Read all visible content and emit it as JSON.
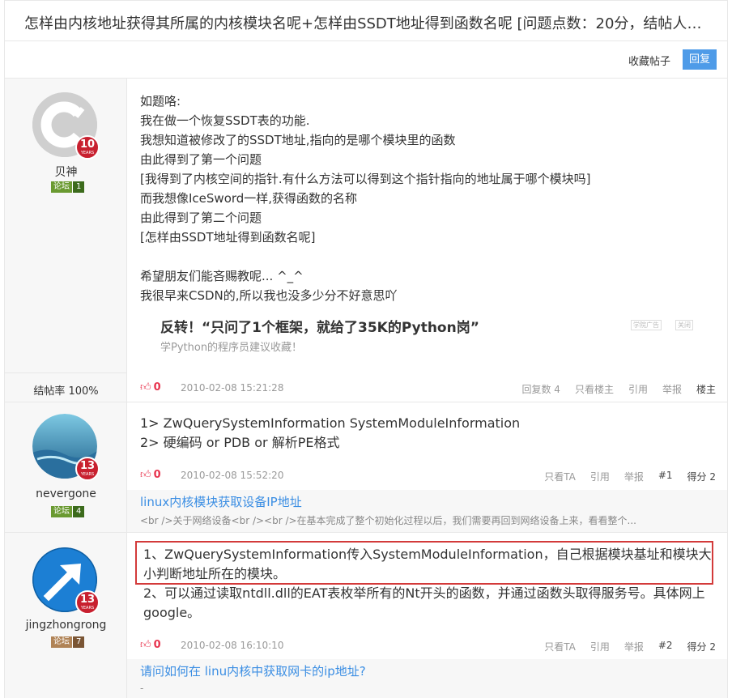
{
  "thread": {
    "title": "怎样由内核地址获得其所属的内核模块名呢+怎样由SSDT地址得到函数名呢 [问题点数：20分，结帖人w...",
    "fav_label": "收藏帖子",
    "reply_label": "回复"
  },
  "posts": [
    {
      "user": "贝神",
      "years": "10",
      "years_label": "YEARS",
      "badge_type": "论坛",
      "badge_level": "1",
      "rate": "结帖率 100%",
      "text": "如题咯:\n我在做一个恢复SSDT表的功能.\n我想知道被修改了的SSDT地址,指向的是哪个模块里的函数\n由此得到了第一个问题\n[我得到了内核空间的指针.有什么方法可以得到这个指针指向的地址属于哪个模块吗]\n而我想像IceSword一样,获得函数的名称\n由此得到了第二个问题\n[怎样由SSDT地址得到函数名呢]\n\n希望朋友们能吝赐教呢...  ^_^\n我很早来CSDN的,所以我也没多少分不好意思吖",
      "ad_title": "反转！“只问了1个框架，就给了35K的Python岗”",
      "ad_sub": "学Python的程序员建议收藏！",
      "ad_tag1": "学院广告",
      "ad_tag2": "关闭",
      "likes": "0",
      "time": "2010-02-08 15:21:28",
      "actions": [
        "回复数 4",
        "只看楼主",
        "引用",
        "举报",
        "楼主"
      ]
    },
    {
      "user": "nevergone",
      "years": "13",
      "years_label": "YEARS",
      "badge_type": "论坛",
      "badge_level": "4",
      "text": "1> ZwQuerySystemInformation SystemModuleInformation\n2> 硬编码 or PDB or 解析PE格式",
      "likes": "0",
      "time": "2010-02-08 15:52:20",
      "actions": [
        "只看TA",
        "引用",
        "举报",
        "#1",
        "得分 2"
      ],
      "related_title": "linux内核模块获取设备IP地址",
      "related_sub": "<br />关于网络设备<br /><br />在基本完成了整个初始化过程以后，我们需要再回到网络设备上来，看看整个..."
    },
    {
      "user": "jingzhongrong",
      "years": "13",
      "years_label": "YEARS",
      "badge_type": "论坛",
      "badge_level": "7",
      "text_highlight": "1、ZwQuerySystemInformation传入SystemModuleInformation，自己根据模块基址和模块大小判断地址所在的模块。",
      "text": "2、可以通过读取ntdll.dll的EAT表枚举所有的Nt开头的函数，并通过函数头取得服务号。具体网上google。",
      "likes": "0",
      "time": "2010-02-08 16:10:10",
      "actions": [
        "只看TA",
        "引用",
        "举报",
        "#2",
        "得分 2"
      ],
      "related_title": "请问如何在 linu内核中获取网卡的ip地址?",
      "related_sub": "-"
    }
  ],
  "colors": {
    "accent": "#4e9be8",
    "link": "#3b8ee3",
    "like": "#e8344e",
    "highlight": "#d33a3a"
  }
}
